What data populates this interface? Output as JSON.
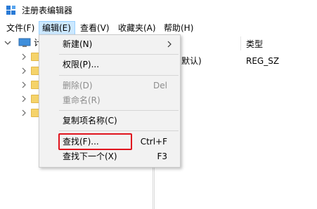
{
  "window": {
    "title": "注册表编辑器"
  },
  "menubar": {
    "items": [
      {
        "label": "文件(F)"
      },
      {
        "label": "编辑(E)"
      },
      {
        "label": "查看(V)"
      },
      {
        "label": "收藏夹(A)"
      },
      {
        "label": "帮助(H)"
      }
    ]
  },
  "tree": {
    "root_label": "计"
  },
  "list": {
    "column_type": "类型",
    "rows": [
      {
        "name": "默认)",
        "type": "REG_SZ"
      }
    ]
  },
  "edit_menu": {
    "items": [
      {
        "label": "新建(N)",
        "shortcut": "",
        "has_submenu": true,
        "disabled": false
      },
      {
        "label": "权限(P)...",
        "shortcut": "",
        "disabled": false
      },
      {
        "label": "删除(D)",
        "shortcut": "Del",
        "disabled": true
      },
      {
        "label": "重命名(R)",
        "shortcut": "",
        "disabled": true
      },
      {
        "label": "复制项名称(C)",
        "shortcut": "",
        "disabled": false
      },
      {
        "label": "查找(F)...",
        "shortcut": "Ctrl+F",
        "disabled": false,
        "highlighted": true
      },
      {
        "label": "查找下一个(X)",
        "shortcut": "F3",
        "disabled": false
      }
    ]
  },
  "colors": {
    "highlight_border": "#e0141e",
    "menu_active_bg": "#cce8ff"
  }
}
